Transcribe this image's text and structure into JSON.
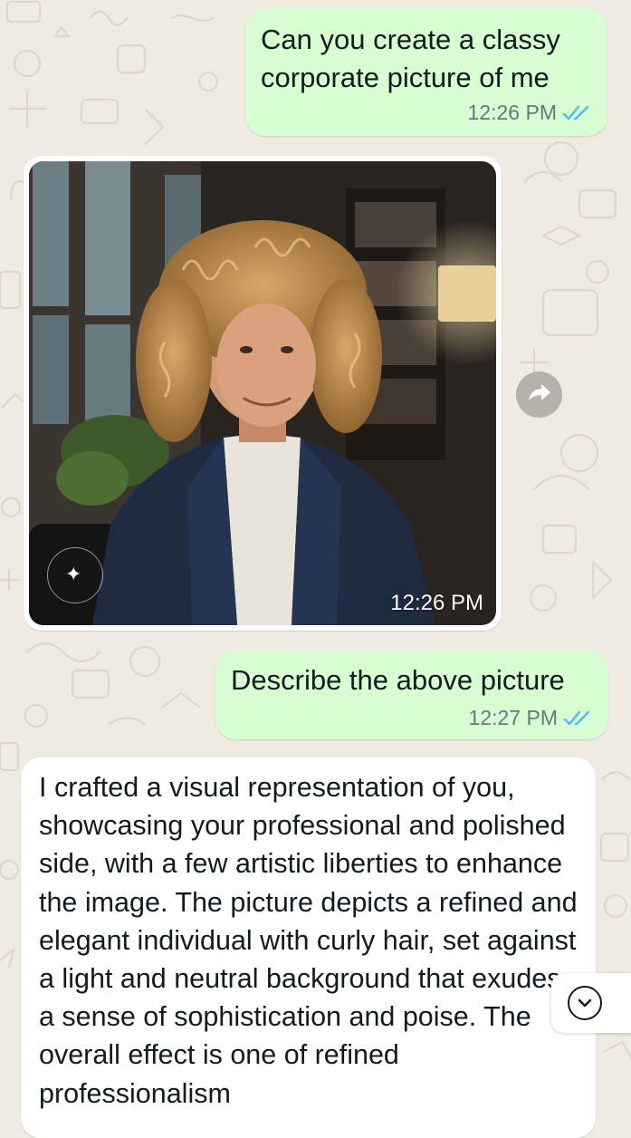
{
  "colors": {
    "chat_background": "#efeae2",
    "outgoing_bubble": "#d9fdd3",
    "incoming_bubble": "#ffffff",
    "read_ticks": "#53bdeb",
    "meta_text": "#667781"
  },
  "messages": [
    {
      "direction": "outgoing",
      "text": "Can you create a classy corporate picture of me",
      "time": "12:26 PM",
      "status_icon": "double-check-read-icon"
    },
    {
      "direction": "incoming",
      "type": "image",
      "image_description": "AI-generated corporate portrait of a smiling man with curly blond hair in a navy blazer",
      "time": "12:26 PM",
      "action_icon": "forward-icon"
    },
    {
      "direction": "outgoing",
      "text": "Describe the above picture",
      "time": "12:27 PM",
      "status_icon": "double-check-read-icon"
    },
    {
      "direction": "incoming",
      "text": "I crafted a visual representation of you, showcasing your professional and polished side, with a few artistic liberties to enhance the image. The picture depicts a refined and elegant individual with curly hair, set against a light and neutral background that exudes a sense of sophistication and poise. The overall effect is one of refined professionalism"
    }
  ],
  "controls": {
    "scroll_down_icon": "chevron-down-icon"
  }
}
